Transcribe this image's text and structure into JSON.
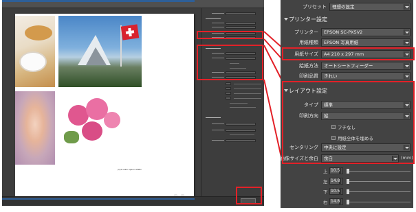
{
  "colors": {
    "highlight_red": "#e32128",
    "panel_background": "#434343",
    "control_fill": "#585858",
    "accent_blue": "#2e5f98"
  },
  "small_screenshot": {
    "photo_credit": "(C)2 seiko epson wWBc",
    "canvas_status": "図 - 図"
  },
  "zoom_panel": {
    "preset": {
      "label": "プリセット",
      "value": "理想の設定"
    },
    "printer_section": {
      "title": "プリンター設定",
      "rows": [
        {
          "label": "プリンター",
          "value": "EPSON SC-PX5V2"
        },
        {
          "label": "用紙種類",
          "value": "EPSON 写真用紙"
        },
        {
          "label": "用紙サイズ",
          "value": "A4 210 x 297 mm"
        },
        {
          "label": "給紙方法",
          "value": "オートシートフィーダー"
        },
        {
          "label": "印刷品質",
          "value": "きれい"
        }
      ]
    },
    "layout_section": {
      "title": "レイアウト設定",
      "type": {
        "label": "タイプ",
        "value": "標準"
      },
      "orientation": {
        "label": "印刷方向",
        "value": "縦"
      },
      "borderless": {
        "label": "フチなし",
        "checked": false
      },
      "fill_paper": {
        "label": "用紙全体を埋める",
        "checked": false
      },
      "centering": {
        "label": "センタリング",
        "value": "中央に設定"
      },
      "image_size": {
        "label": "画像サイズと余白",
        "value": "余白",
        "unit": "(mm)"
      },
      "margins": [
        {
          "label": "上",
          "value": "10.5",
          "position": 0.0
        },
        {
          "label": "左",
          "value": "14.8",
          "position": 0.0
        },
        {
          "label": "下",
          "value": "10.5",
          "position": 0.0
        },
        {
          "label": "右",
          "value": "14.8",
          "position": 0.0
        }
      ]
    }
  }
}
